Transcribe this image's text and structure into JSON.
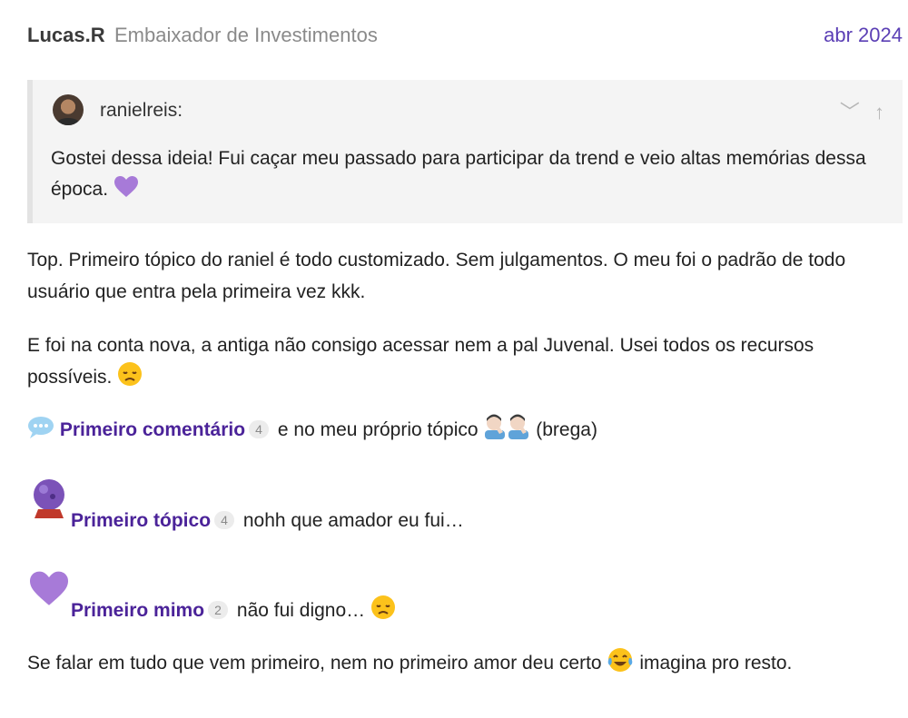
{
  "post": {
    "username": "Lucas.R",
    "user_title": "Embaixador de Investimentos",
    "date": "abr 2024"
  },
  "quote": {
    "author": "ranielreis:",
    "text": "Gostei dessa ideia! Fui caçar meu passado para participar da trend e veio altas memórias dessa época.",
    "controls": {
      "expand": "﹀",
      "up": "↑"
    }
  },
  "body": {
    "p1": "Top. Primeiro tópico do raniel é todo customizado. Sem julgamentos. O meu foi o padrão de todo usuário que entra pela primeira vez kkk.",
    "p2": "E foi na conta nova, a antiga não consigo acessar nem a pal Juvenal. Usei todos os recursos possíveis.",
    "badge1": {
      "label": "Primeiro comentário",
      "count": "4",
      "after": "e no meu próprio tópico",
      "suffix": "(brega)"
    },
    "badge2": {
      "label": "Primeiro tópico",
      "count": "4",
      "after": "nohh que amador eu fui…"
    },
    "badge3": {
      "label": "Primeiro mimo",
      "count": "2",
      "after": "não fui digno…"
    },
    "p6_a": "Se falar em tudo que vem primeiro, nem no primeiro amor deu certo",
    "p6_b": "imagina pro resto."
  },
  "icons": {
    "heart": "purple-heart-icon",
    "disappointed": "disappointed-face-icon",
    "speech": "speech-balloon-icon",
    "facepalm": "man-facepalming-icon",
    "crystal_ball": "crystal-ball-icon",
    "joy": "face-with-tears-of-joy-icon"
  },
  "colors": {
    "link": "#4b2399",
    "date": "#5b3fb5",
    "quote_bg": "#f4f4f4"
  }
}
